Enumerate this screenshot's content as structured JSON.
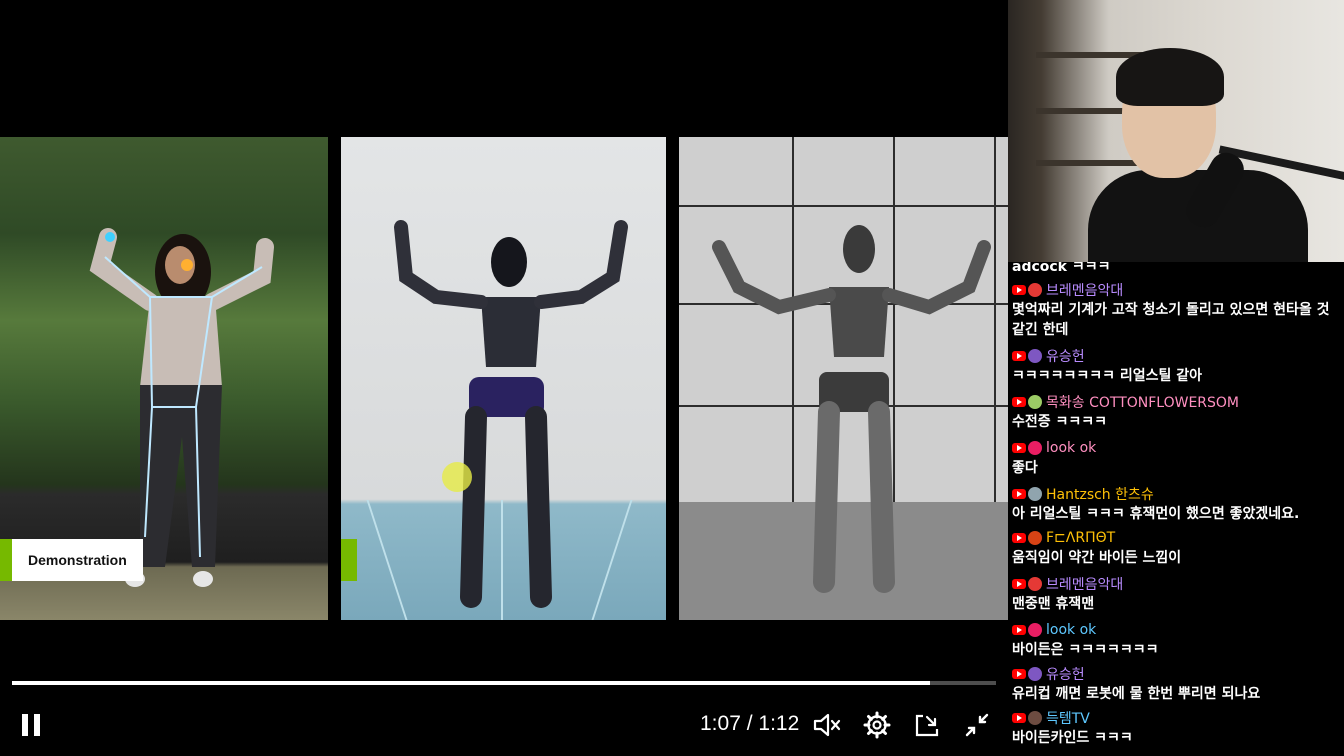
{
  "player": {
    "overlay_label": "Demonstration",
    "time_current": "1:07",
    "time_separator": "/",
    "time_total": "1:12",
    "progress_fraction": 0.933,
    "controls": {
      "pause_icon": "pause-icon",
      "mute_icon": "volume-muted-icon",
      "settings_icon": "gear-icon",
      "pip_icon": "picture-in-picture-icon",
      "exit_fullscreen_icon": "exit-fullscreen-icon"
    },
    "accent_color": "#76b900"
  },
  "chat": {
    "partial_line": "adcock ㅋㅋㅋ",
    "messages": [
      {
        "author": "브레멘음악대",
        "author_color": "#b98cff",
        "avatar_color": "#e53935",
        "text": "몇억짜리 기계가 고작 청소기 돌리고 있으면 현타올 것 같긴 한데"
      },
      {
        "author": "유승헌",
        "author_color": "#b98cff",
        "avatar_color": "#7e57c2",
        "text": "ㅋㅋㅋㅋㅋㅋㅋㅋ 리얼스틸 같아"
      },
      {
        "author": "목화송 COTTONFLOWERSOM",
        "author_color": "#ff8fc0",
        "avatar_color": "#9ccc65",
        "text": "수전증 ㅋㅋㅋㅋ"
      },
      {
        "author": "look ok",
        "author_color": "#ff8fc0",
        "avatar_color": "#e91e63",
        "text": "좋다"
      },
      {
        "author": "Hantzsch 한츠슈",
        "author_color": "#ffc107",
        "avatar_color": "#90a4ae",
        "text": "아 리얼스틸 ㅋㅋㅋ 휴잭먼이 했으면 좋았겠네요."
      },
      {
        "author": "F⊏ΛRΠΘT",
        "author_color": "#ffc107",
        "avatar_color": "#d84315",
        "text": "움직임이 약간 바이든 느낌이"
      },
      {
        "author": "브레멘음악대",
        "author_color": "#b98cff",
        "avatar_color": "#e53935",
        "text": "맨중맨 휴잭맨"
      },
      {
        "author": "look ok",
        "author_color": "#5ec8ff",
        "avatar_color": "#e91e63",
        "text": "바이든은 ㅋㅋㅋㅋㅋㅋㅋ"
      },
      {
        "author": "유승헌",
        "author_color": "#b98cff",
        "avatar_color": "#7e57c2",
        "text": "유리컵 깨면 로봇에 물 한번 뿌리면 되나요"
      },
      {
        "author": "득템TV",
        "author_color": "#5ec8ff",
        "avatar_color": "#6d4c41",
        "text": "바이든카인드 ㅋㅋㅋ"
      }
    ]
  }
}
